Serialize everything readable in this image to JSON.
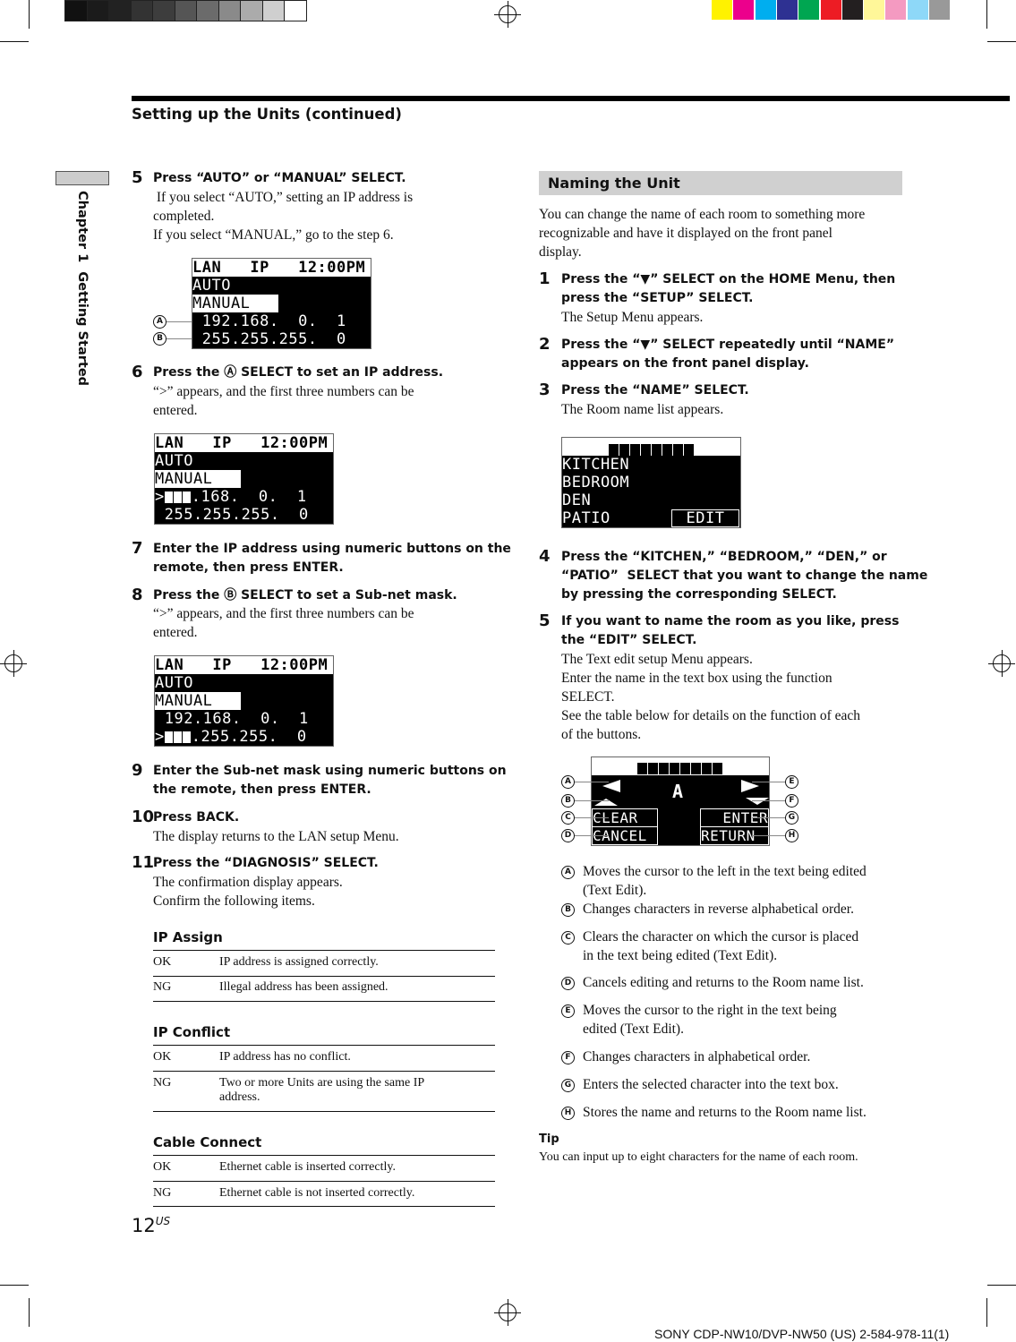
{
  "print_marks": {
    "gray_swatches": [
      "#111111",
      "#1b1b1b",
      "#222222",
      "#333333",
      "#3d3d3d",
      "#555555",
      "#6b6b6b",
      "#8a8a8a",
      "#ababab",
      "#cfcfcf",
      "#ffffff"
    ],
    "color_swatches": [
      "#fff200",
      "#ec008c",
      "#00aeef",
      "#2e3192",
      "#00a651",
      "#ed1c24",
      "#231f20",
      "#fff799",
      "#f49ac1",
      "#8ed8f8",
      "#999999"
    ]
  },
  "header": {
    "title": "Setting up the Units (continued)"
  },
  "sidebar": {
    "label": "Chapter 1  Getting Started"
  },
  "left": {
    "s5": {
      "num": "5",
      "head": "Press “AUTO” or “MANUAL” SELECT.",
      "body1": " If you select “AUTO,” setting an IP address is",
      "body2": "completed.",
      "body3": "If you select “MANUAL,” go to the step 6."
    },
    "lcd1": {
      "r1": "LAN   IP   12:00PM",
      "r2": "AUTO",
      "r3": "MANUAL",
      "r4": " 192.168.  0.  1",
      "r5": " 255.255.255.  0",
      "markA": "A",
      "markB": "B"
    },
    "s6": {
      "num": "6",
      "head": "Press the Ⓐ SELECT to set an IP address.",
      "body1": "“>” appears, and the first three numbers can be",
      "body2": "entered."
    },
    "lcd2": {
      "r1": "LAN   IP   12:00PM",
      "r2": "AUTO",
      "r3": "MANUAL",
      "r4": ".168.  0.  1",
      "r5": " 255.255.255.  0"
    },
    "s7": {
      "num": "7",
      "head1": "Enter the IP address using numeric buttons on the",
      "head2": "remote, then press ENTER."
    },
    "s8": {
      "num": "8",
      "head": "Press the Ⓑ SELECT to set a Sub-net mask.",
      "body1": "“>” appears, and the first three numbers can be",
      "body2": "entered."
    },
    "lcd3": {
      "r1": "LAN   IP   12:00PM",
      "r2": "AUTO",
      "r3": "MANUAL",
      "r4": " 192.168.  0.  1",
      "r5": ".255.255.  0"
    },
    "s9": {
      "num": "9",
      "head1": "Enter the Sub-net mask using numeric buttons on",
      "head2": "the remote, then press ENTER."
    },
    "s10": {
      "num": "10",
      "head": "Press BACK.",
      "body1": "The display returns to the LAN setup Menu."
    },
    "s11": {
      "num": "11",
      "head": "Press the “DIAGNOSIS” SELECT.",
      "body1": "The confirmation display appears.",
      "body2": "Confirm the following items."
    },
    "tables": [
      {
        "title": "IP Assign",
        "rows": [
          {
            "k": "OK",
            "v": "IP address is assigned correctly."
          },
          {
            "k": "NG",
            "v": "Illegal address has been assigned."
          }
        ]
      },
      {
        "title": "IP Conflict",
        "rows": [
          {
            "k": "OK",
            "v": "IP address has no conflict."
          },
          {
            "k": "NG",
            "v": "Two or more Units are using the same IP",
            "v2": "address."
          }
        ]
      },
      {
        "title": "Cable Connect",
        "rows": [
          {
            "k": "OK",
            "v": "Ethernet cable is inserted correctly."
          },
          {
            "k": "NG",
            "v": "Ethernet cable is not inserted correctly."
          }
        ]
      }
    ]
  },
  "right": {
    "section_title": "Naming the Unit",
    "intro1": "You can change the name of each room to something more",
    "intro2": "recognizable and have it displayed on the front panel",
    "intro3": "display.",
    "s1": {
      "num": "1",
      "head1": "Press the “▼” SELECT on the HOME Menu, then",
      "head2": "press the “SETUP” SELECT.",
      "body1": "The Setup Menu appears."
    },
    "s2": {
      "num": "2",
      "head1": "Press the “▼” SELECT repeatedly until “NAME”",
      "head2": "appears on the front panel display."
    },
    "s3": {
      "num": "3",
      "head": "Press the “NAME” SELECT.",
      "body1": "The Room name list appears."
    },
    "lcd_rooms": {
      "r2": "KITCHEN",
      "r3": "BEDROOM",
      "r4": "DEN",
      "r5": "PATIO",
      "edit": "EDIT"
    },
    "s4": {
      "num": "4",
      "head1": "Press the “KITCHEN,” “BEDROOM,” “DEN,” or",
      "head2": "“PATIO”  SELECT that you want to change the name",
      "head3": "by pressing the corresponding SELECT."
    },
    "s5": {
      "num": "5",
      "head1": "If you want to name the room as you like, press",
      "head2": "the “EDIT” SELECT.",
      "body1": "The Text edit setup Menu appears.",
      "body2": "Enter the name in the text box using the function",
      "body3": "SELECT.",
      "body4": "See the table below for details on the function of each",
      "body5": "of the buttons."
    },
    "lcd_edit": {
      "char": "A",
      "clear": "CLEAR",
      "cancel": "CANCEL",
      "enter": "ENTER",
      "return": "RETURN",
      "marks": [
        "A",
        "B",
        "C",
        "D",
        "E",
        "F",
        "G",
        "H"
      ]
    },
    "legend": [
      {
        "mark": "A",
        "t1": "Moves the cursor to the left in the text being edited",
        "t2": "(Text Edit)."
      },
      {
        "mark": "B",
        "t1": "Changes characters in reverse alphabetical order."
      },
      {
        "mark": "C",
        "t1": "Clears the character on which the cursor is placed",
        "t2": "in the text being edited (Text Edit)."
      },
      {
        "mark": "D",
        "t1": "Cancels editing and returns to the Room name list."
      },
      {
        "mark": "E",
        "t1": "Moves the cursor to the right in the text being",
        "t2": "edited (Text Edit)."
      },
      {
        "mark": "F",
        "t1": "Changes characters in alphabetical order."
      },
      {
        "mark": "G",
        "t1": "Enters the selected character into the text box."
      },
      {
        "mark": "H",
        "t1": "Stores the name and returns to the Room name list."
      }
    ],
    "tip_label": "Tip",
    "tip_text": "You can input up to eight characters for the name of each room."
  },
  "footer": {
    "page_num": "12",
    "page_suffix": "US",
    "code": "SONY CDP-NW10/DVP-NW50 (US) 2-584-978-11(1)"
  }
}
